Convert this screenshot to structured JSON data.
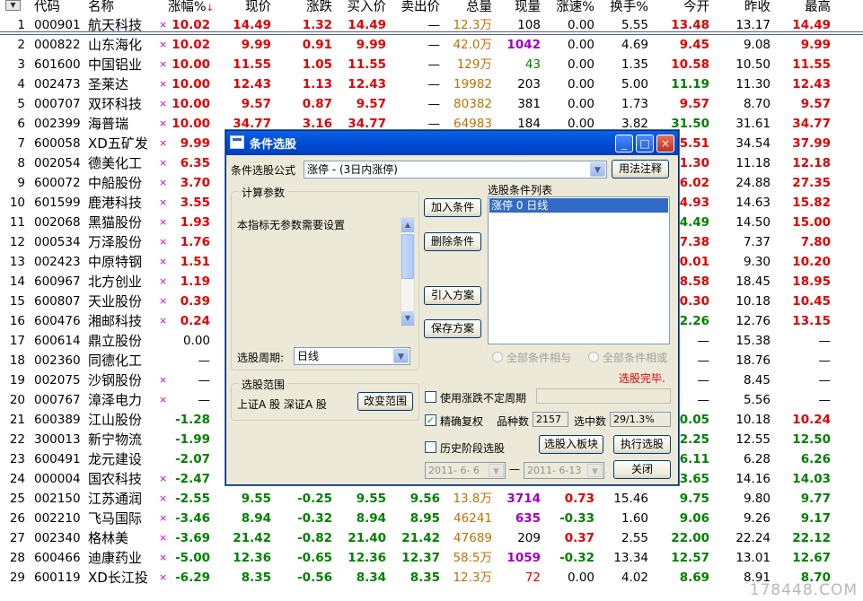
{
  "headers": [
    "代码",
    "名称",
    "涨幅%",
    "现价",
    "涨跌",
    "买入价",
    "卖出价",
    "总量",
    "现量",
    "涨速%",
    "换手%",
    "今开",
    "昨收",
    "最高"
  ],
  "sort_indicator": "↓",
  "sort_button": "▼",
  "rows": [
    {
      "n": "1",
      "code": "000901",
      "name": "航天科技",
      "mark": "×",
      "chg": "10.02",
      "price": "14.49",
      "diff": "1.32",
      "bid": "14.49",
      "ask": "—",
      "vol": "12.3万",
      "cur": "108",
      "spd": "0.00",
      "turn": "5.55",
      "open": "13.48",
      "prev": "13.17",
      "high": "14.49"
    },
    {
      "n": "2",
      "code": "000822",
      "name": "山东海化",
      "mark": "×",
      "chg": "10.02",
      "price": "9.99",
      "diff": "0.91",
      "bid": "9.99",
      "ask": "—",
      "vol": "42.0万",
      "cur": "1042",
      "spd": "0.00",
      "turn": "4.69",
      "open": "9.45",
      "prev": "9.08",
      "high": "9.99"
    },
    {
      "n": "3",
      "code": "601600",
      "name": "中国铝业",
      "mark": "×",
      "chg": "10.00",
      "price": "11.55",
      "diff": "1.05",
      "bid": "11.55",
      "ask": "—",
      "vol": "129万",
      "cur": "43",
      "spd": "0.00",
      "turn": "1.35",
      "open": "10.58",
      "prev": "10.50",
      "high": "11.55"
    },
    {
      "n": "4",
      "code": "002473",
      "name": "圣莱达",
      "mark": "×",
      "chg": "10.00",
      "price": "12.43",
      "diff": "1.13",
      "bid": "12.43",
      "ask": "—",
      "vol": "19982",
      "cur": "203",
      "spd": "0.00",
      "turn": "5.00",
      "open": "11.19",
      "prev": "11.30",
      "high": "12.43"
    },
    {
      "n": "5",
      "code": "000707",
      "name": "双环科技",
      "mark": "×",
      "chg": "10.00",
      "price": "9.57",
      "diff": "0.87",
      "bid": "9.57",
      "ask": "—",
      "vol": "80382",
      "cur": "381",
      "spd": "0.00",
      "turn": "1.73",
      "open": "9.57",
      "prev": "8.70",
      "high": "9.57"
    },
    {
      "n": "6",
      "code": "002399",
      "name": "海普瑞",
      "mark": "×",
      "chg": "10.00",
      "price": "34.77",
      "diff": "3.16",
      "bid": "34.77",
      "ask": "—",
      "vol": "64983",
      "cur": "184",
      "spd": "0.00",
      "turn": "3.82",
      "open": "31.50",
      "prev": "31.61",
      "high": "34.77"
    },
    {
      "n": "7",
      "code": "600058",
      "name": "XD五矿发",
      "mark": "×",
      "chg": "9.99",
      "price": "",
      "diff": "",
      "bid": "",
      "ask": "",
      "vol": "",
      "cur": "",
      "spd": "",
      "turn": "",
      "open": "35.51",
      "prev": "34.54",
      "high": "37.99"
    },
    {
      "n": "8",
      "code": "002054",
      "name": "德美化工",
      "mark": "×",
      "chg": "6.35",
      "price": "",
      "diff": "",
      "bid": "",
      "ask": "",
      "vol": "",
      "cur": "",
      "spd": "",
      "turn": "",
      "open": "11.30",
      "prev": "11.18",
      "high": "12.18"
    },
    {
      "n": "9",
      "code": "600072",
      "name": "中船股份",
      "mark": "×",
      "chg": "3.70",
      "price": "",
      "diff": "",
      "bid": "",
      "ask": "",
      "vol": "",
      "cur": "",
      "spd": "",
      "turn": "",
      "open": "26.02",
      "prev": "24.88",
      "high": "27.35"
    },
    {
      "n": "10",
      "code": "601599",
      "name": "鹿港科技",
      "mark": "×",
      "chg": "3.55",
      "price": "",
      "diff": "",
      "bid": "",
      "ask": "",
      "vol": "",
      "cur": "",
      "spd": "",
      "turn": "",
      "open": "14.93",
      "prev": "14.63",
      "high": "15.82"
    },
    {
      "n": "11",
      "code": "002068",
      "name": "黑猫股份",
      "mark": "×",
      "chg": "1.93",
      "price": "",
      "diff": "",
      "bid": "",
      "ask": "",
      "vol": "",
      "cur": "",
      "spd": "",
      "turn": "",
      "open": "14.49",
      "prev": "14.50",
      "high": "15.00"
    },
    {
      "n": "12",
      "code": "000534",
      "name": "万泽股份",
      "mark": "×",
      "chg": "1.76",
      "price": "",
      "diff": "",
      "bid": "",
      "ask": "",
      "vol": "",
      "cur": "",
      "spd": "",
      "turn": "",
      "open": "7.38",
      "prev": "7.37",
      "high": "7.80"
    },
    {
      "n": "13",
      "code": "002423",
      "name": "中原特钢",
      "mark": "×",
      "chg": "1.51",
      "price": "",
      "diff": "",
      "bid": "",
      "ask": "",
      "vol": "",
      "cur": "",
      "spd": "",
      "turn": "",
      "open": "10.01",
      "prev": "9.30",
      "high": "10.20"
    },
    {
      "n": "14",
      "code": "600967",
      "name": "北方创业",
      "mark": "×",
      "chg": "1.19",
      "price": "",
      "diff": "",
      "bid": "",
      "ask": "",
      "vol": "",
      "cur": "",
      "spd": "",
      "turn": "",
      "open": "18.58",
      "prev": "18.45",
      "high": "18.95"
    },
    {
      "n": "15",
      "code": "600807",
      "name": "天业股份",
      "mark": "×",
      "chg": "0.39",
      "price": "",
      "diff": "",
      "bid": "",
      "ask": "",
      "vol": "",
      "cur": "",
      "spd": "",
      "turn": "",
      "open": "10.30",
      "prev": "10.18",
      "high": "10.45"
    },
    {
      "n": "16",
      "code": "600476",
      "name": "湘邮科技",
      "mark": "×",
      "chg": "0.24",
      "price": "",
      "diff": "",
      "bid": "",
      "ask": "",
      "vol": "",
      "cur": "",
      "spd": "",
      "turn": "",
      "open": "12.26",
      "prev": "12.76",
      "high": "13.15"
    },
    {
      "n": "17",
      "code": "600614",
      "name": "鼎立股份",
      "mark": "",
      "chg": "0.00",
      "price": "",
      "diff": "",
      "bid": "",
      "ask": "",
      "vol": "",
      "cur": "",
      "spd": "",
      "turn": "",
      "open": "—",
      "prev": "15.38",
      "high": "—"
    },
    {
      "n": "18",
      "code": "002360",
      "name": "同德化工",
      "mark": "",
      "chg": "—",
      "price": "",
      "diff": "",
      "bid": "",
      "ask": "",
      "vol": "",
      "cur": "",
      "spd": "",
      "turn": "",
      "open": "—",
      "prev": "18.76",
      "high": "—"
    },
    {
      "n": "19",
      "code": "002075",
      "name": "沙钢股份",
      "mark": "×",
      "chg": "—",
      "price": "",
      "diff": "",
      "bid": "",
      "ask": "",
      "vol": "",
      "cur": "",
      "spd": "",
      "turn": "",
      "open": "—",
      "prev": "8.45",
      "high": "—"
    },
    {
      "n": "20",
      "code": "000767",
      "name": "漳泽电力",
      "mark": "×",
      "chg": "—",
      "price": "",
      "diff": "",
      "bid": "",
      "ask": "",
      "vol": "",
      "cur": "",
      "spd": "",
      "turn": "",
      "open": "—",
      "prev": "5.56",
      "high": "—"
    },
    {
      "n": "21",
      "code": "600389",
      "name": "江山股份",
      "mark": "",
      "chg": "-1.28",
      "price": "",
      "diff": "",
      "bid": "",
      "ask": "",
      "vol": "",
      "cur": "",
      "spd": "",
      "turn": "",
      "open": "10.05",
      "prev": "10.18",
      "high": "10.24"
    },
    {
      "n": "22",
      "code": "300013",
      "name": "新宁物流",
      "mark": "",
      "chg": "-1.99",
      "price": "",
      "diff": "",
      "bid": "",
      "ask": "",
      "vol": "",
      "cur": "",
      "spd": "",
      "turn": "",
      "open": "12.25",
      "prev": "12.55",
      "high": "12.50"
    },
    {
      "n": "23",
      "code": "600491",
      "name": "龙元建设",
      "mark": "",
      "chg": "-2.07",
      "price": "",
      "diff": "",
      "bid": "",
      "ask": "",
      "vol": "",
      "cur": "",
      "spd": "",
      "turn": "",
      "open": "6.11",
      "prev": "6.28",
      "high": "6.26"
    },
    {
      "n": "24",
      "code": "000004",
      "name": "国农科技",
      "mark": "×",
      "chg": "-2.47",
      "price": "",
      "diff": "",
      "bid": "",
      "ask": "",
      "vol": "",
      "cur": "",
      "spd": "",
      "turn": "",
      "open": "13.65",
      "prev": "14.16",
      "high": "14.03"
    },
    {
      "n": "25",
      "code": "002150",
      "name": "江苏通润",
      "mark": "×",
      "chg": "-2.55",
      "price": "9.55",
      "diff": "-0.25",
      "bid": "9.55",
      "ask": "9.56",
      "vol": "13.8万",
      "cur": "3714",
      "spd": "0.73",
      "turn": "15.46",
      "open": "9.75",
      "prev": "9.80",
      "high": "9.77"
    },
    {
      "n": "26",
      "code": "002210",
      "name": "飞马国际",
      "mark": "×",
      "chg": "-3.46",
      "price": "8.94",
      "diff": "-0.32",
      "bid": "8.94",
      "ask": "8.95",
      "vol": "46241",
      "cur": "635",
      "spd": "-0.33",
      "turn": "1.60",
      "open": "9.06",
      "prev": "9.26",
      "high": "9.17"
    },
    {
      "n": "27",
      "code": "002340",
      "name": "格林美",
      "mark": "×",
      "chg": "-3.69",
      "price": "21.42",
      "diff": "-0.82",
      "bid": "21.40",
      "ask": "21.42",
      "vol": "47689",
      "cur": "209",
      "spd": "0.37",
      "turn": "2.55",
      "open": "22.00",
      "prev": "22.24",
      "high": "22.12"
    },
    {
      "n": "28",
      "code": "600466",
      "name": "迪康药业",
      "mark": "×",
      "chg": "-5.00",
      "price": "12.36",
      "diff": "-0.65",
      "bid": "12.36",
      "ask": "12.37",
      "vol": "58.5万",
      "cur": "1059",
      "spd": "-0.32",
      "turn": "13.34",
      "open": "12.57",
      "prev": "13.01",
      "high": "12.67"
    },
    {
      "n": "29",
      "code": "600119",
      "name": "XD长江投",
      "mark": "×",
      "chg": "-6.29",
      "price": "8.35",
      "diff": "-0.56",
      "bid": "8.34",
      "ask": "8.35",
      "vol": "12.3万",
      "cur": "72",
      "spd": "0.00",
      "turn": "4.02",
      "open": "8.69",
      "prev": "8.91",
      "high": "8.70"
    }
  ],
  "dialog": {
    "title": "条件选股",
    "min_glyph": "_",
    "max_glyph": "□",
    "close_glyph": "×",
    "formula_label": "条件选股公式",
    "formula_value": "涨停    - (3日内涨停)",
    "usage_button": "用法注释",
    "params_group": "计算参数",
    "params_note": "本指标无参数需要设置",
    "period_label": "选股周期:",
    "period_value": "日线",
    "add_button": "加入条件",
    "delete_button": "删除条件",
    "import_button": "引入方案",
    "save_button": "保存方案",
    "list_label": "选股条件列表",
    "list_items": [
      "涨停  0  日线"
    ],
    "radio_and": "全部条件相与",
    "radio_or": "全部条件相或",
    "status": "选股完毕.",
    "range_group": "选股范围",
    "range_value": "上证A 股  深证A 股",
    "change_range_button": "改变范围",
    "use_uncertain_label": "使用涨跌不定周期",
    "exact_restore_label": "精确复权",
    "species_label": "品种数",
    "species_value": "2157",
    "selected_label": "选中数",
    "selected_value": "29/1.3%",
    "history_label": "历史阶段选股",
    "to_block_button": "选股入板块",
    "execute_button": "执行选股",
    "date_from": "2011- 6- 6",
    "date_sep": "—",
    "date_to": "2011- 6-13",
    "close_button": "关闭",
    "check_mark": "✓",
    "dd_arrow": "▼",
    "scroll_up": "▲",
    "scroll_down": "▼"
  },
  "watermark": "178448.COM"
}
